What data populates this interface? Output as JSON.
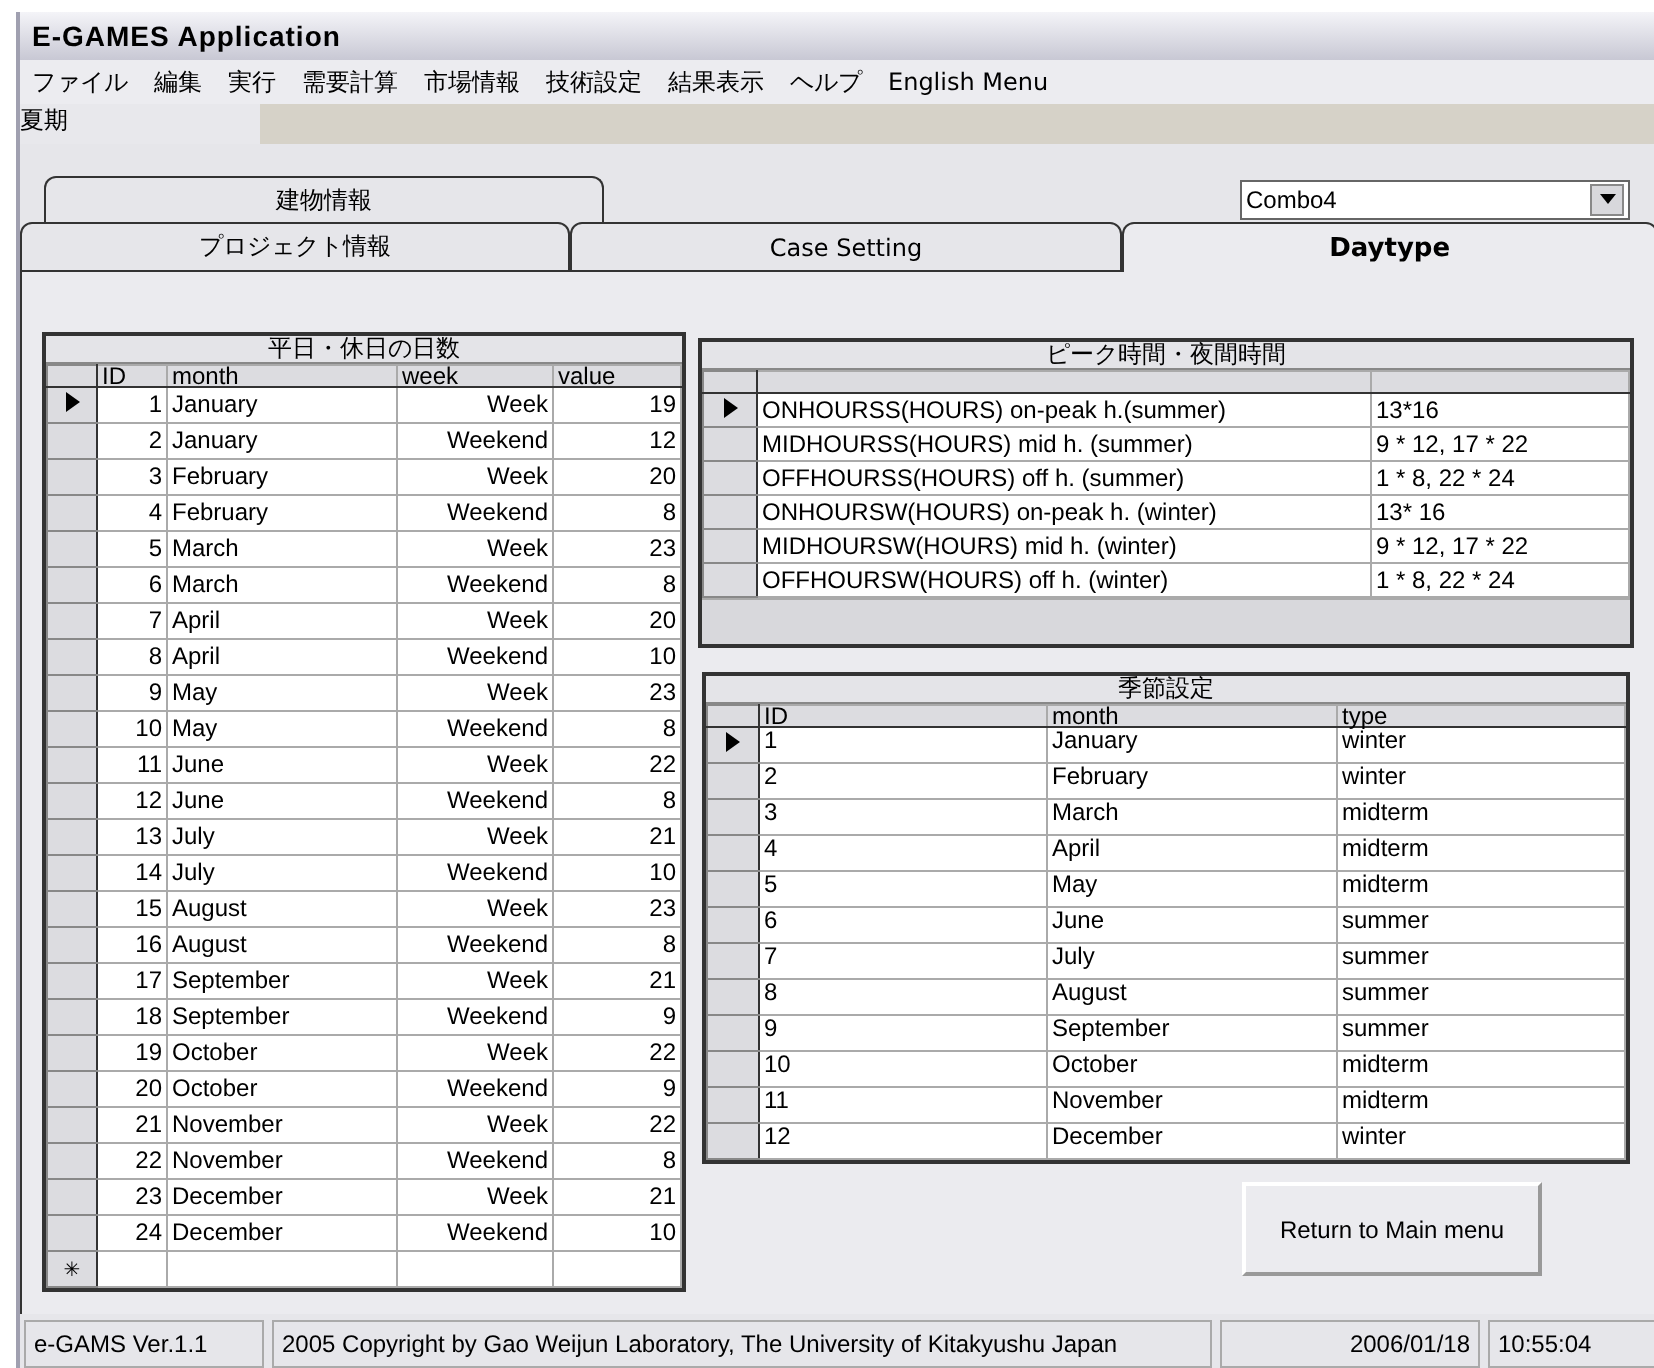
{
  "window": {
    "title": "E-GAMES Application"
  },
  "menu": [
    "ファイル",
    "編集",
    "実行",
    "需要計算",
    "市場情報",
    "技術設定",
    "結果表示",
    "ヘルプ",
    "English Menu"
  ],
  "mode_label": "夏期",
  "tab_rows": [
    {
      "tabs": [
        {
          "label": "建物情報",
          "selected": false
        }
      ]
    },
    {
      "tabs": [
        {
          "label": "プロジェクト情報",
          "selected": false
        },
        {
          "label": "Case Setting",
          "selected": false
        },
        {
          "label": "Daytype",
          "selected": true
        }
      ]
    }
  ],
  "combo": {
    "value": "Combo4"
  },
  "days_table": {
    "caption": "平日・休日の日数",
    "columns": [
      "ID",
      "month",
      "week",
      "value"
    ],
    "new_row_marker": "✳",
    "rows": [
      {
        "id": "1",
        "month": "January",
        "week": "Week",
        "value": "19",
        "selected": true
      },
      {
        "id": "2",
        "month": "January",
        "week": "Weekend",
        "value": "12",
        "selected": false
      },
      {
        "id": "3",
        "month": "February",
        "week": "Week",
        "value": "20",
        "selected": false
      },
      {
        "id": "4",
        "month": "February",
        "week": "Weekend",
        "value": "8",
        "selected": false
      },
      {
        "id": "5",
        "month": "March",
        "week": "Week",
        "value": "23",
        "selected": false
      },
      {
        "id": "6",
        "month": "March",
        "week": "Weekend",
        "value": "8",
        "selected": false
      },
      {
        "id": "7",
        "month": "April",
        "week": "Week",
        "value": "20",
        "selected": false
      },
      {
        "id": "8",
        "month": "April",
        "week": "Weekend",
        "value": "10",
        "selected": false
      },
      {
        "id": "9",
        "month": "May",
        "week": "Week",
        "value": "23",
        "selected": false
      },
      {
        "id": "10",
        "month": "May",
        "week": "Weekend",
        "value": "8",
        "selected": false
      },
      {
        "id": "11",
        "month": "June",
        "week": "Week",
        "value": "22",
        "selected": false
      },
      {
        "id": "12",
        "month": "June",
        "week": "Weekend",
        "value": "8",
        "selected": false
      },
      {
        "id": "13",
        "month": "July",
        "week": "Week",
        "value": "21",
        "selected": false
      },
      {
        "id": "14",
        "month": "July",
        "week": "Weekend",
        "value": "10",
        "selected": false
      },
      {
        "id": "15",
        "month": "August",
        "week": "Week",
        "value": "23",
        "selected": false
      },
      {
        "id": "16",
        "month": "August",
        "week": "Weekend",
        "value": "8",
        "selected": false
      },
      {
        "id": "17",
        "month": "September",
        "week": "Week",
        "value": "21",
        "selected": false
      },
      {
        "id": "18",
        "month": "September",
        "week": "Weekend",
        "value": "9",
        "selected": false
      },
      {
        "id": "19",
        "month": "October",
        "week": "Week",
        "value": "22",
        "selected": false
      },
      {
        "id": "20",
        "month": "October",
        "week": "Weekend",
        "value": "9",
        "selected": false
      },
      {
        "id": "21",
        "month": "November",
        "week": "Week",
        "value": "22",
        "selected": false
      },
      {
        "id": "22",
        "month": "November",
        "week": "Weekend",
        "value": "8",
        "selected": false
      },
      {
        "id": "23",
        "month": "December",
        "week": "Week",
        "value": "21",
        "selected": false
      },
      {
        "id": "24",
        "month": "December",
        "week": "Weekend",
        "value": "10",
        "selected": false
      }
    ]
  },
  "hours_table": {
    "caption": "ピーク時間・夜間時間",
    "rows": [
      {
        "name": "ONHOURSS(HOURS)  on-peak h.(summer)",
        "value": "13*16",
        "selected": true
      },
      {
        "name": "MIDHOURSS(HOURS) mid h. (summer)",
        "value": "9 * 12, 17 * 22",
        "selected": false
      },
      {
        "name": "OFFHOURSS(HOURS) off h. (summer)",
        "value": "1 * 8, 22 * 24",
        "selected": false
      },
      {
        "name": "ONHOURSW(HOURS) on-peak h. (winter)",
        "value": "13* 16",
        "selected": false
      },
      {
        "name": "MIDHOURSW(HOURS) mid h. (winter)",
        "value": "9 * 12, 17 * 22",
        "selected": false
      },
      {
        "name": "OFFHOURSW(HOURS) off h. (winter)",
        "value": "1 * 8, 22 * 24",
        "selected": false
      }
    ]
  },
  "season_table": {
    "caption": "季節設定",
    "columns": [
      "ID",
      "month",
      "type"
    ],
    "rows": [
      {
        "id": "1",
        "month": "January",
        "type": "winter",
        "selected": true
      },
      {
        "id": "2",
        "month": "February",
        "type": "winter",
        "selected": false
      },
      {
        "id": "3",
        "month": "March",
        "type": "midterm",
        "selected": false
      },
      {
        "id": "4",
        "month": "April",
        "type": "midterm",
        "selected": false
      },
      {
        "id": "5",
        "month": "May",
        "type": "midterm",
        "selected": false
      },
      {
        "id": "6",
        "month": "June",
        "type": "summer",
        "selected": false
      },
      {
        "id": "7",
        "month": "July",
        "type": "summer",
        "selected": false
      },
      {
        "id": "8",
        "month": "August",
        "type": "summer",
        "selected": false
      },
      {
        "id": "9",
        "month": "September",
        "type": "summer",
        "selected": false
      },
      {
        "id": "10",
        "month": "October",
        "type": "midterm",
        "selected": false
      },
      {
        "id": "11",
        "month": "November",
        "type": "midterm",
        "selected": false
      },
      {
        "id": "12",
        "month": "December",
        "type": "winter",
        "selected": false
      }
    ]
  },
  "return_button": "Return to Main menu",
  "status_bar": [
    "e-GAMS Ver.1.1",
    "2005 Copyright by Gao Weijun Laboratory, The University of Kitakyushu Japan",
    "2006/01/18",
    "10:55:04"
  ]
}
